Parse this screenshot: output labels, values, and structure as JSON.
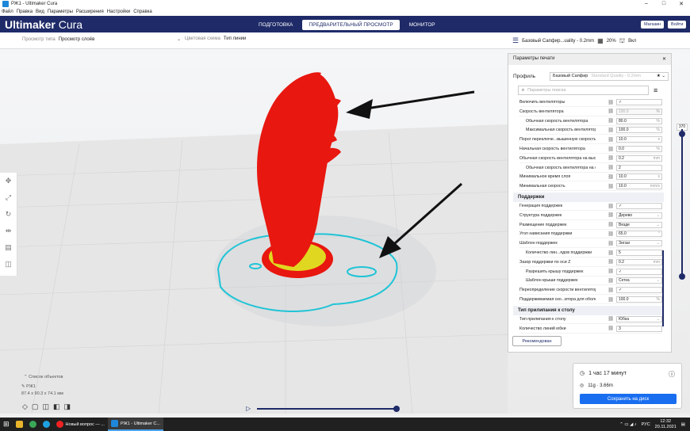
{
  "window": {
    "title": "РЖ1 - Ultimaker Cura"
  },
  "menu": [
    "Файл",
    "Правка",
    "Вид",
    "Параметры",
    "Расширения",
    "Настройки",
    "Справка"
  ],
  "app": {
    "brand_bold": "Ultimaker",
    "brand_light": "Cura"
  },
  "stages": [
    {
      "label": "ПОДГОТОВКА"
    },
    {
      "label": "ПРЕДВАРИТЕЛЬНЫЙ ПРОСМОТР"
    },
    {
      "label": "МОНИТОР"
    }
  ],
  "topright": {
    "marketplace": "Магазин",
    "login": "Войти"
  },
  "header": {
    "view_type_label": "Просмотр типа",
    "view_type_value": "Просмотр слоёв",
    "color_scheme_label": "Цветовая схема",
    "color_scheme_value": "Тип линии",
    "profile_summary": "Базовый Сапфир...uality - 0.2mm",
    "infill": "20%",
    "support": "Вкл"
  },
  "panel": {
    "title": "Параметры печати",
    "profile_label": "Профиль",
    "profile_value": "Базовый Сапфир",
    "profile_hint": "Standard Quality - 0.2mm",
    "search_placeholder": "Параметры поиска",
    "settings_top": [
      {
        "name": "Включить вентиляторы",
        "value": "✓",
        "unit": ""
      },
      {
        "name": "Скорость вентилятора",
        "value": "100.0",
        "unit": "%",
        "disabled": true
      },
      {
        "name": "Обычная скорость вентилятора",
        "value": "80.0",
        "unit": "%"
      },
      {
        "name": "Максимальная скорость вентилятора",
        "value": "100.0",
        "unit": "%"
      },
      {
        "name": "Порог переключе...вышенную скорость",
        "value": "10.0",
        "unit": "s"
      },
      {
        "name": "Начальная скорость вентилятора",
        "value": "0.0",
        "unit": "%"
      },
      {
        "name": "Обычная скорость вентилятора на высоте",
        "value": "0.2",
        "unit": "mm"
      },
      {
        "name": "Обычная скорость вентилятора на слое",
        "value": "2",
        "unit": ""
      },
      {
        "name": "Минимальное время слоя",
        "value": "10.0",
        "unit": "s"
      },
      {
        "name": "Минимальная скорость",
        "value": "10.0",
        "unit": "mm/s"
      }
    ],
    "cat_support": "Поддержки",
    "settings_support": [
      {
        "name": "Генерация поддержек",
        "value": "✓",
        "unit": ""
      },
      {
        "name": "Структура поддержек",
        "value": "Дерево",
        "unit": "⌄"
      },
      {
        "name": "Размещение поддержек",
        "value": "Везде",
        "unit": "⌄"
      },
      {
        "name": "Угол нависания поддержки",
        "value": "65.0",
        "unit": "°"
      },
      {
        "name": "Шаблон поддержек",
        "value": "Зигзаг",
        "unit": "⌄"
      },
      {
        "name": "Количество лин...ядов поддержки",
        "value": "5",
        "unit": ""
      },
      {
        "name": "Зазор поддержки по оси Z",
        "value": "0.2",
        "unit": "mm"
      },
      {
        "name": "Разрешить крышу поддержек",
        "value": "✓",
        "unit": ""
      },
      {
        "name": "Шаблон крыши поддержек",
        "value": "Сетка",
        "unit": "⌄"
      },
      {
        "name": "Переопределение скорости вентилятора",
        "value": "✓",
        "unit": ""
      },
      {
        "name": "Поддерживаемая ско...втора для оболочки",
        "value": "100.0",
        "unit": "%"
      }
    ],
    "cat_adhesion": "Тип прилипания к столу",
    "settings_adhesion": [
      {
        "name": "Тип прилипания к столу",
        "value": "Юбка",
        "unit": "⌄"
      },
      {
        "name": "Количество линий юбки",
        "value": "3",
        "unit": ""
      }
    ],
    "recommended": "Рекомендован"
  },
  "layer_slider": {
    "top": "370"
  },
  "estimate": {
    "time": "1 час 17 минут",
    "material": "11g · 3.66m",
    "save": "Сохранить на диск"
  },
  "objects": {
    "header": "Список объектов",
    "name": "РЖ1",
    "dims": "87.4 x 90.3 x 74.1 мм"
  },
  "taskbar": {
    "tasks": [
      {
        "label": "Новый вопрос — ..."
      },
      {
        "label": "РЖ1 - Ultimaker C..."
      }
    ],
    "lang": "РУС",
    "time": "12:32",
    "date": "20.11.2021"
  },
  "colors": {
    "topbar": "#1f2b68",
    "model_red": "#e8170f",
    "skirt_cyan": "#1fc4d6",
    "accent": "#196ef0"
  }
}
